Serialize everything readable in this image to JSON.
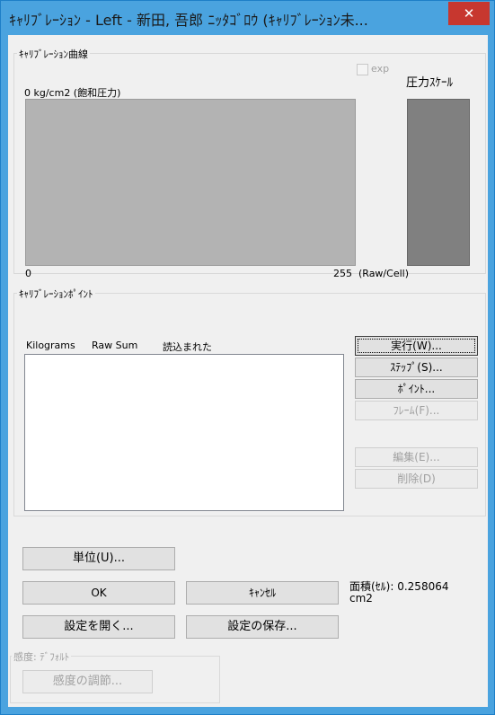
{
  "window": {
    "title": "ｷｬﾘﾌﾞﾚｰｼｮﾝ - Left - 新田, 吾郎 ﾆｯﾀｺﾞﾛｳ (ｷｬﾘﾌﾞﾚｰｼｮﾝ未...",
    "close_label": "✕"
  },
  "curve": {
    "group_title": "ｷｬﾘﾌﾞﾚｰｼｮﾝ曲線",
    "exp_label": "exp",
    "exp_checked": false,
    "pressure_scale_label": "圧力ｽｹｰﾙ",
    "y_label": "0 kg/cm2 (飽和圧力)",
    "x_min": "0",
    "x_max": "255",
    "x_unit": "(Raw/Cell)"
  },
  "points": {
    "group_title": "ｷｬﾘﾌﾞﾚｰｼｮﾝﾎﾟｲﾝﾄ",
    "columns": [
      "Kilograms",
      "Raw Sum",
      "読込まれた"
    ],
    "rows": [],
    "buttons": {
      "run": "実行(W)...",
      "step": "ｽﾃｯﾌﾟ(S)...",
      "point": "ﾎﾟｲﾝﾄ...",
      "frame": "ﾌﾚｰﾑ(F)...",
      "edit": "編集(E)...",
      "delete": "削除(D)"
    }
  },
  "footer": {
    "units": "単位(U)...",
    "ok": "OK",
    "cancel": "ｷｬﾝｾﾙ",
    "area_label": "面積(ｾﾙ): 0.258064",
    "area_unit": "cm2",
    "open_settings": "設定を開く...",
    "save_settings": "設定の保存...",
    "sensitivity_group": "感度: ﾃﾞﾌｫﾙﾄ",
    "sensitivity_adjust": "感度の調節..."
  }
}
